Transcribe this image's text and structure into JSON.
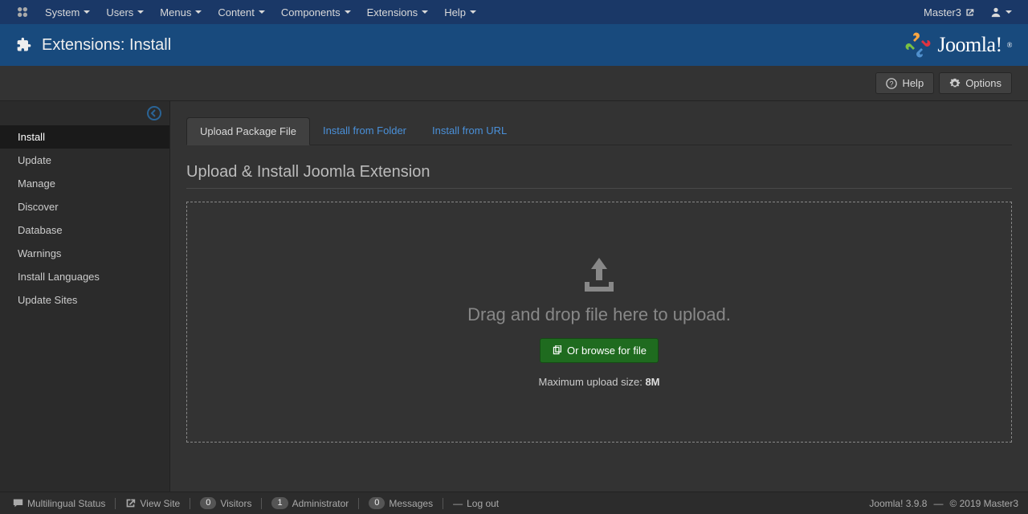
{
  "topmenu": {
    "items": [
      "System",
      "Users",
      "Menus",
      "Content",
      "Components",
      "Extensions",
      "Help"
    ],
    "site_name": "Master3"
  },
  "header": {
    "title": "Extensions: Install",
    "brand": "Joomla!"
  },
  "toolbar": {
    "help": "Help",
    "options": "Options"
  },
  "sidebar": {
    "items": [
      "Install",
      "Update",
      "Manage",
      "Discover",
      "Database",
      "Warnings",
      "Install Languages",
      "Update Sites"
    ],
    "active_index": 0
  },
  "tabs": {
    "items": [
      "Upload Package File",
      "Install from Folder",
      "Install from URL"
    ],
    "active_index": 0
  },
  "main": {
    "subtitle": "Upload & Install Joomla Extension",
    "drop_text": "Drag and drop file here to upload.",
    "browse_btn": "Or browse for file",
    "max_upload_label": "Maximum upload size: ",
    "max_upload_value": "8M"
  },
  "footer": {
    "multilingual": "Multilingual Status",
    "view_site": "View Site",
    "visitors_count": "0",
    "visitors": "Visitors",
    "admins_count": "1",
    "admins": "Administrator",
    "messages_count": "0",
    "messages": "Messages",
    "logout": "Log out",
    "version": "Joomla! 3.9.8",
    "sep": " — ",
    "copyright": "© 2019 Master3"
  }
}
